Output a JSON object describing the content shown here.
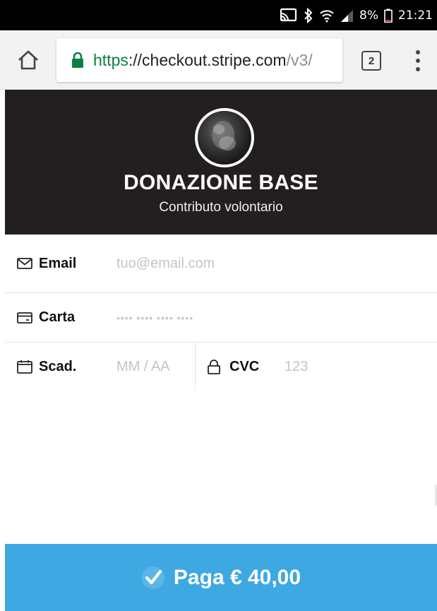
{
  "statusbar": {
    "battery": "8%",
    "time": "21:21"
  },
  "browser": {
    "url_scheme": "https",
    "url_host": "://checkout.stripe.com",
    "url_path": "/v3/",
    "tab_count": "2"
  },
  "header": {
    "title": "DONAZIONE BASE",
    "subtitle": "Contributo volontario"
  },
  "form": {
    "email": {
      "label": "Email",
      "placeholder": "tuo@email.com"
    },
    "card": {
      "label": "Carta",
      "placeholder": "•••• •••• •••• ••••"
    },
    "expiry": {
      "label": "Scad.",
      "placeholder": "MM / AA"
    },
    "cvc": {
      "label": "CVC",
      "placeholder": "123"
    }
  },
  "pay_button": {
    "label": "Paga € 40,00"
  },
  "colors": {
    "header_bg": "#231f20",
    "pay_button_bg": "#3ea8e2",
    "url_secure": "#0b8043",
    "placeholder": "#c5c5c5"
  }
}
